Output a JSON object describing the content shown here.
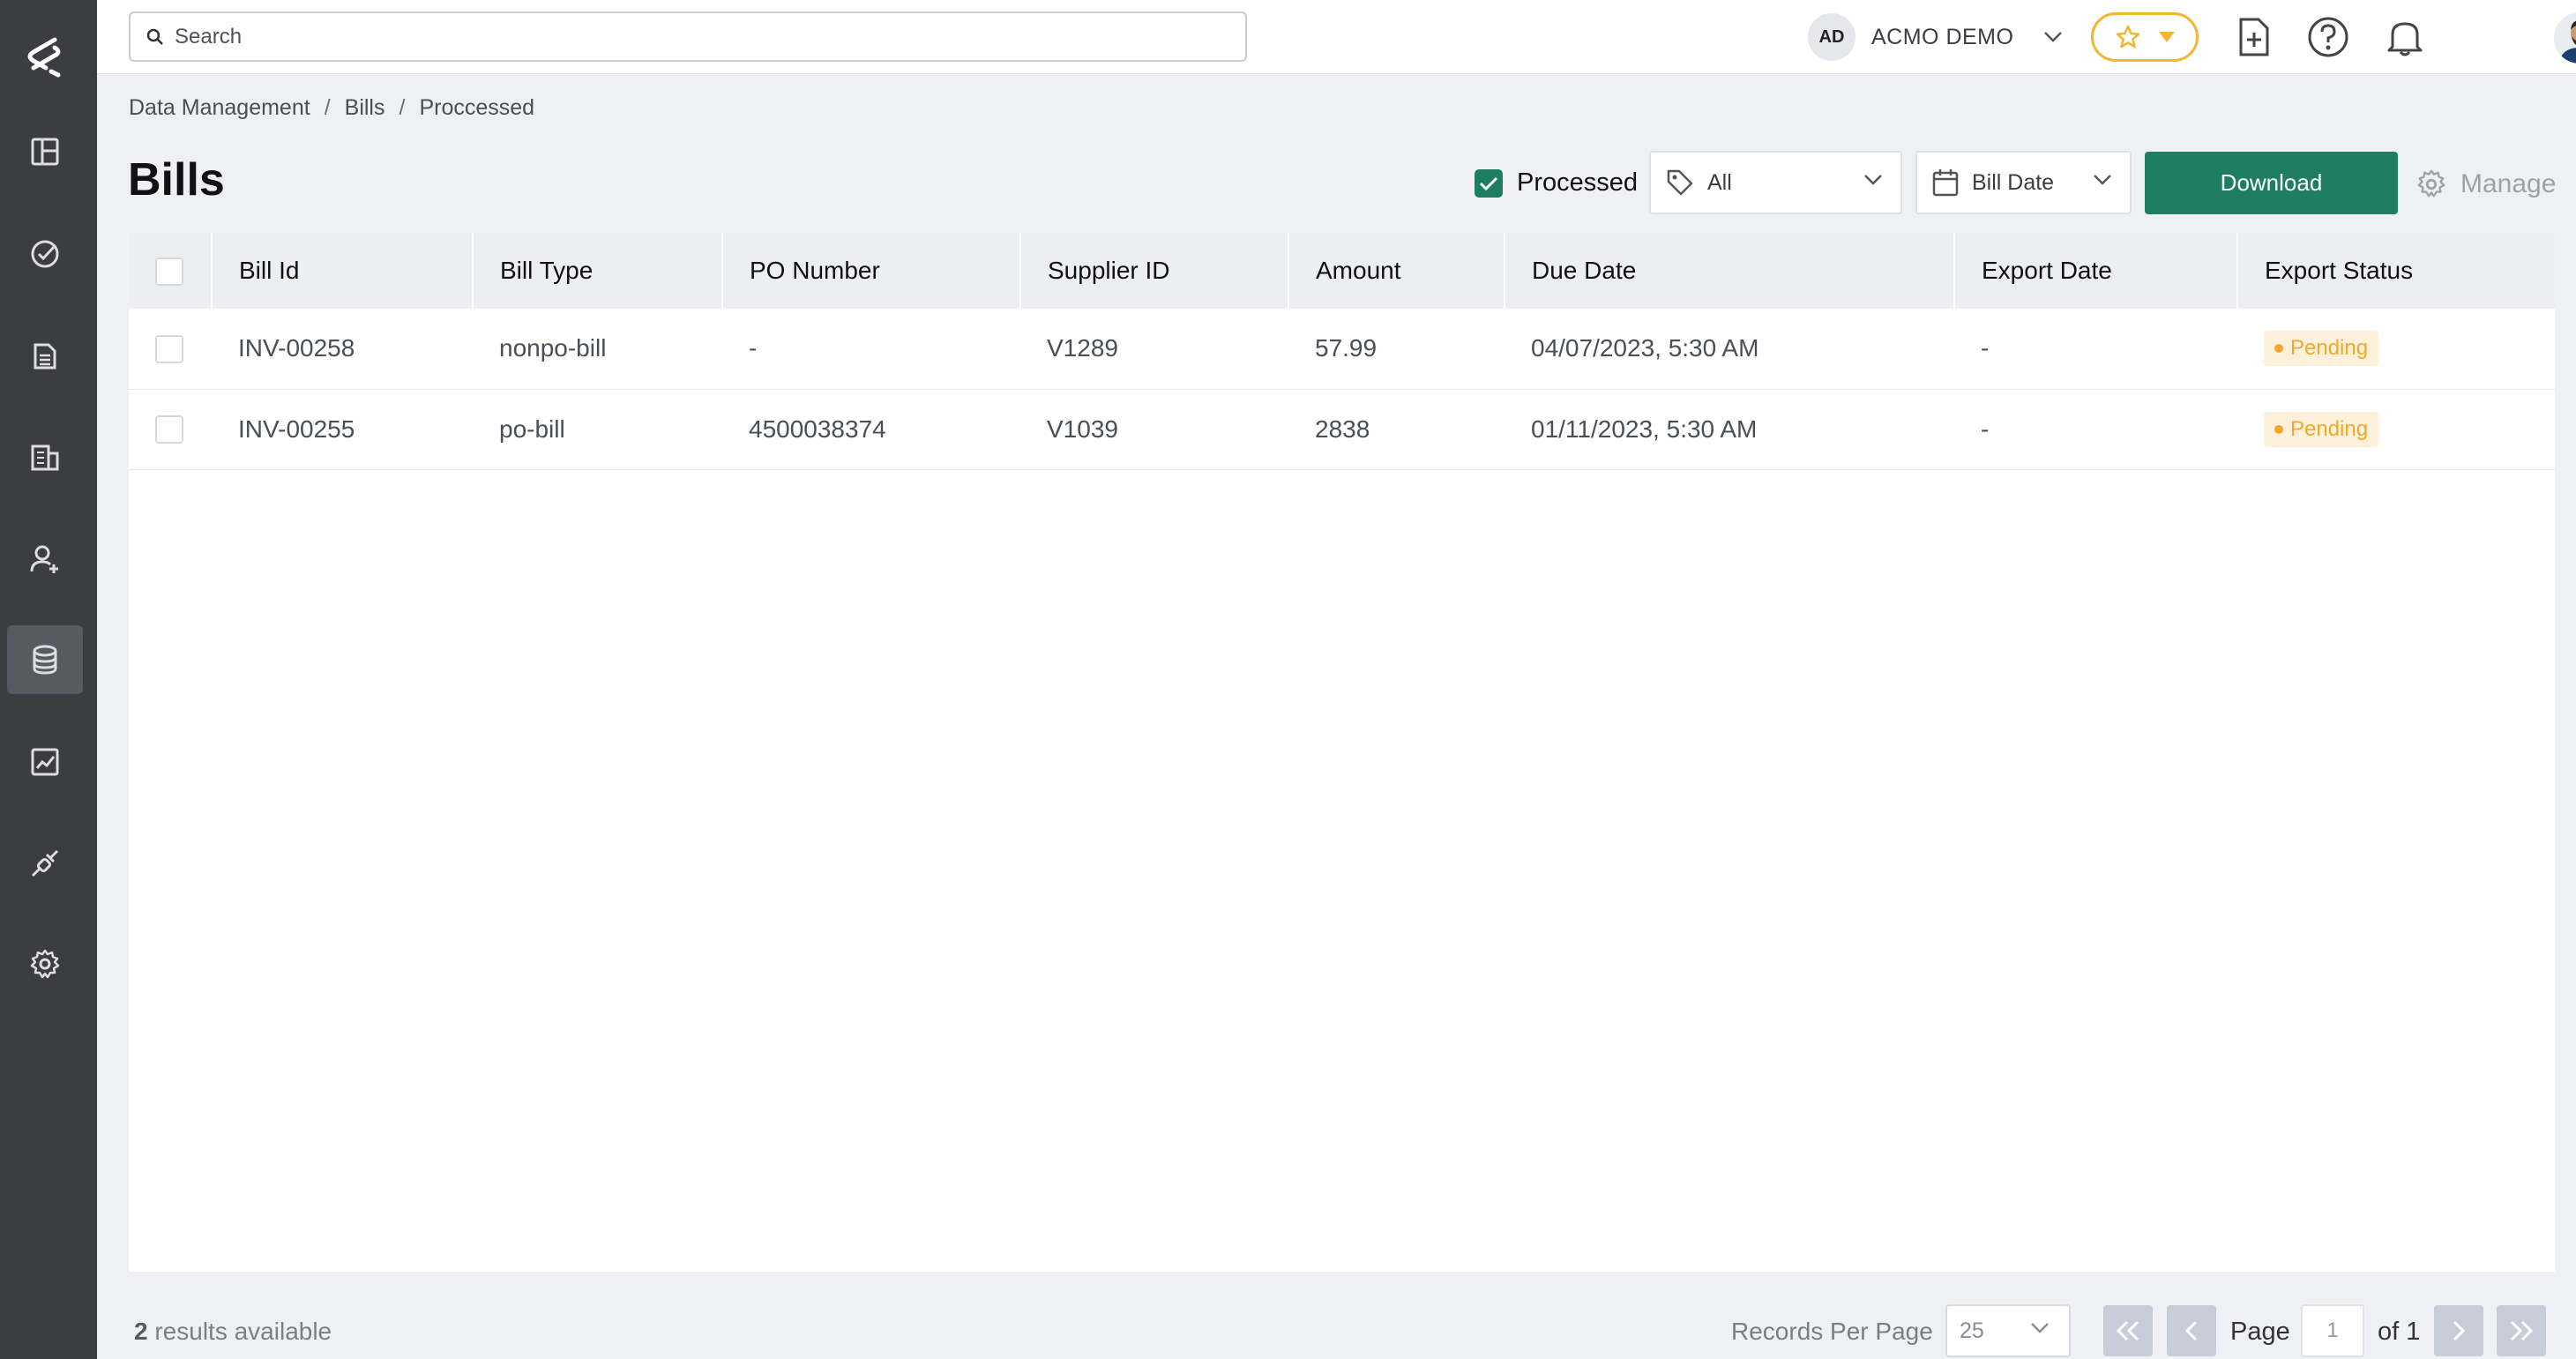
{
  "header": {
    "search_placeholder": "Search",
    "org_initials": "AD",
    "org_name": "ACMO DEMO"
  },
  "sidebar": {
    "items": [
      {
        "icon": "dashboard-icon"
      },
      {
        "icon": "tasks-icon"
      },
      {
        "icon": "documents-icon"
      },
      {
        "icon": "building-icon"
      },
      {
        "icon": "add-user-icon"
      },
      {
        "icon": "database-icon",
        "active": true
      },
      {
        "icon": "analytics-icon"
      },
      {
        "icon": "integrations-icon"
      },
      {
        "icon": "settings-icon"
      }
    ]
  },
  "breadcrumb": [
    "Data Management",
    "Bills",
    "Proccessed"
  ],
  "page_title": "Bills",
  "toolbar": {
    "processed_label": "Processed",
    "processed_checked": true,
    "tag_filter": "All",
    "date_filter": "Bill Date",
    "download_label": "Download",
    "manage_label": "Manage"
  },
  "table": {
    "columns": [
      "Bill Id",
      "Bill Type",
      "PO Number",
      "Supplier ID",
      "Amount",
      "Due Date",
      "Export Date",
      "Export Status"
    ],
    "rows": [
      {
        "bill_id": "INV-00258",
        "bill_type": "nonpo-bill",
        "po_number": "-",
        "supplier_id": "V1289",
        "amount": "57.99",
        "due_date": "04/07/2023, 5:30 AM",
        "export_date": "-",
        "export_status": "Pending"
      },
      {
        "bill_id": "INV-00255",
        "bill_type": "po-bill",
        "po_number": "4500038374",
        "supplier_id": "V1039",
        "amount": "2838",
        "due_date": "01/11/2023, 5:30 AM",
        "export_date": "-",
        "export_status": "Pending"
      }
    ]
  },
  "footer": {
    "results_count": "2",
    "results_text": "results available",
    "records_per_page_label": "Records Per Page",
    "records_per_page": "25",
    "page_label": "Page",
    "page_current": "1",
    "page_total_label": "of 1"
  },
  "colors": {
    "accent": "#1e7e62",
    "sidebar_bg": "#3b3d40",
    "pending": "#f0a92b",
    "favorites": "#f3b533"
  }
}
